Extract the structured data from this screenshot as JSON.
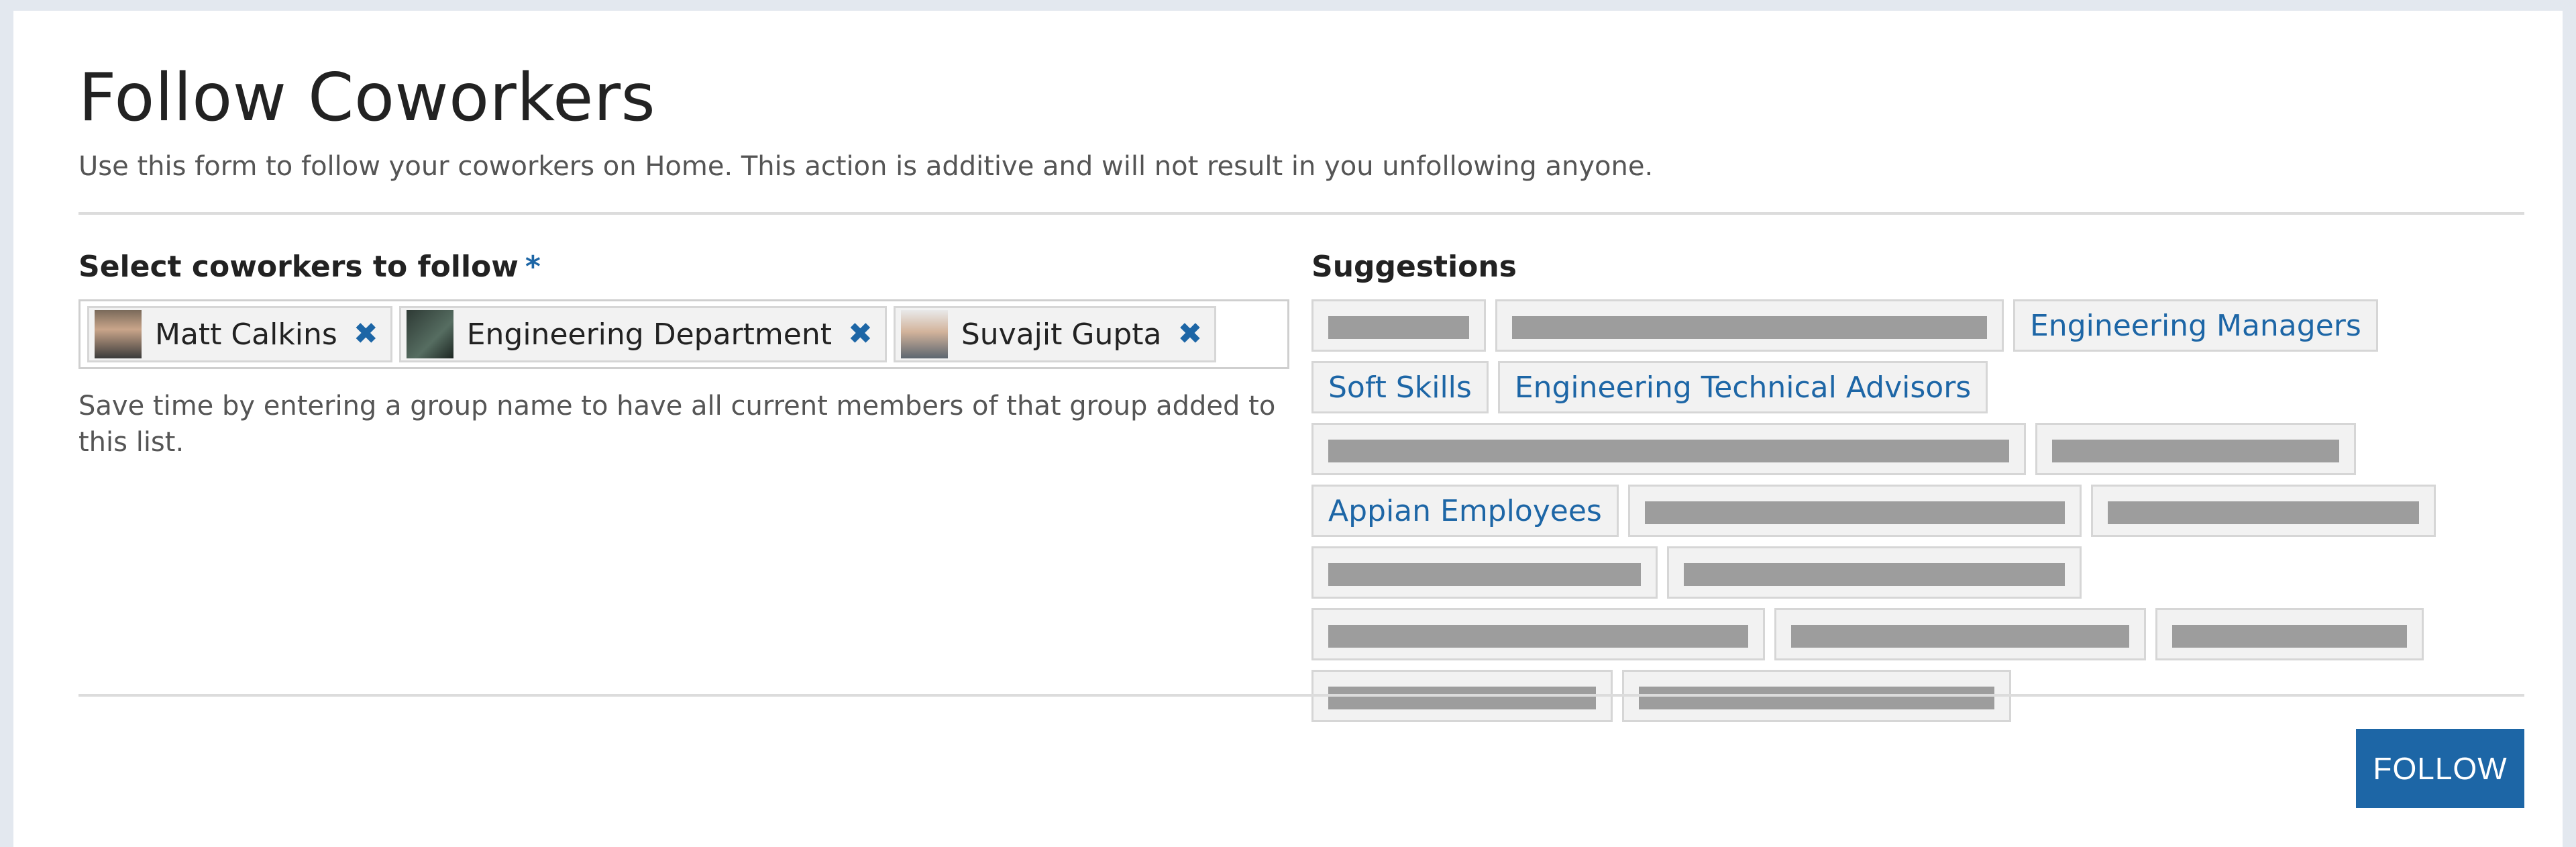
{
  "header": {
    "title": "Follow Coworkers",
    "subtitle": "Use this form to follow your coworkers on Home. This action is additive and will not result in you unfollowing anyone."
  },
  "picker": {
    "label": "Select coworkers to follow",
    "required_marker": "*",
    "tokens": [
      {
        "label": "Matt Calkins",
        "avatar": "person-avatar",
        "remove_icon": "close-icon"
      },
      {
        "label": "Engineering Department",
        "avatar": "group-avatar",
        "remove_icon": "close-icon"
      },
      {
        "label": "Suvajit Gupta",
        "avatar": "person-avatar",
        "remove_icon": "close-icon"
      }
    ],
    "remove_glyph": "✖",
    "help_text": "Save time by entering a group name to have all current members of that group added to this list."
  },
  "suggestions": {
    "label": "Suggestions",
    "items": [
      {
        "label": "█████",
        "redacted": true
      },
      {
        "label": "██████████████████████",
        "redacted": true
      },
      {
        "label": "Engineering Managers",
        "redacted": false
      },
      {
        "label": "Soft Skills",
        "redacted": false
      },
      {
        "label": "Engineering Technical Advisors",
        "redacted": false
      },
      {
        "label": "██████████████████████████",
        "redacted": true
      },
      {
        "label": "████████████",
        "redacted": true
      },
      {
        "label": "Appian Employees",
        "redacted": false
      },
      {
        "label": "█████████████████",
        "redacted": true
      },
      {
        "label": "██████████████",
        "redacted": true
      },
      {
        "label": "██████████████",
        "redacted": true
      },
      {
        "label": "█████████████████",
        "redacted": true
      },
      {
        "label": "██████████████████",
        "redacted": true
      },
      {
        "label": "██████████████",
        "redacted": true
      },
      {
        "label": "██████████",
        "redacted": true
      },
      {
        "label": "██████████",
        "redacted": true
      },
      {
        "label": "████████████████",
        "redacted": true
      }
    ]
  },
  "actions": {
    "follow_label": "FOLLOW"
  },
  "colors": {
    "accent": "#1d66a6",
    "chip_bg": "#f2f2f2",
    "redaction": "#9d9d9d"
  }
}
